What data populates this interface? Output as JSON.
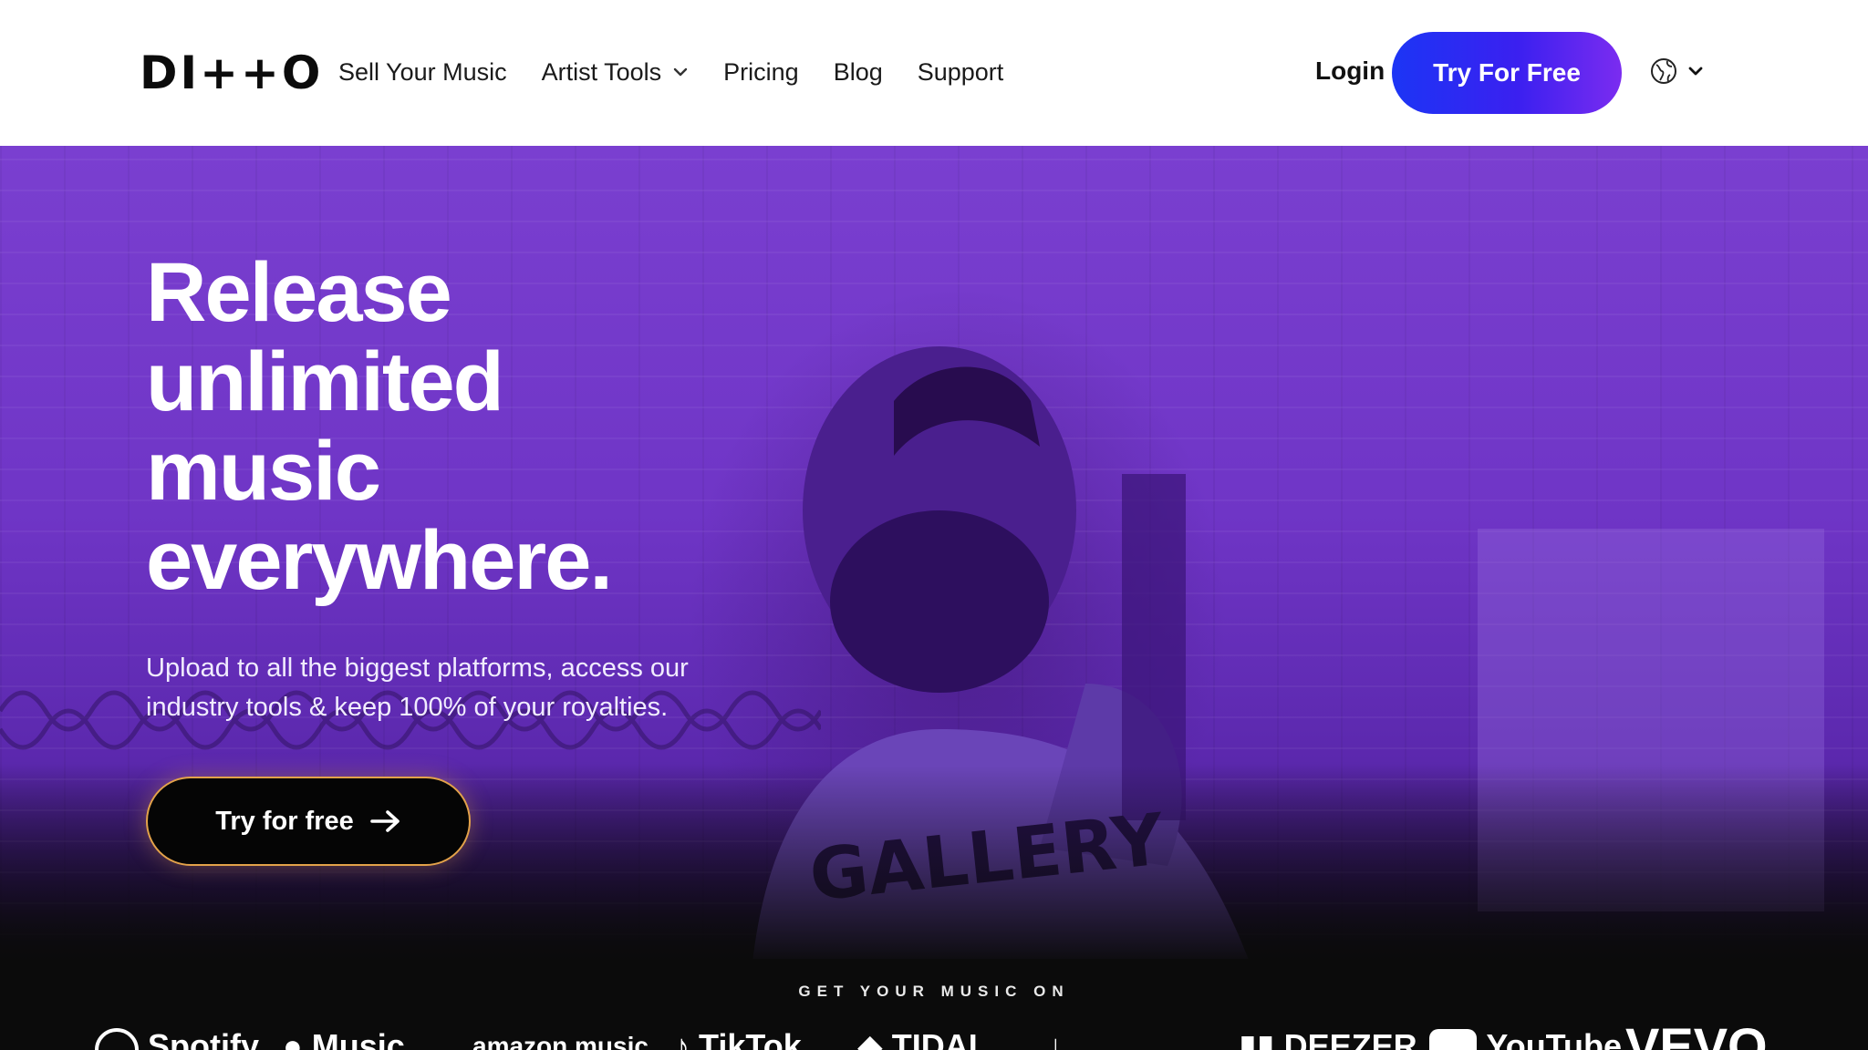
{
  "header": {
    "logo": "DI++O",
    "nav": [
      {
        "label": "Sell Your Music"
      },
      {
        "label": "Artist Tools",
        "has_dropdown": true
      },
      {
        "label": "Pricing"
      },
      {
        "label": "Blog"
      },
      {
        "label": "Support"
      }
    ],
    "login_label": "Login",
    "cta_label": "Try For Free",
    "language_icon": "globe-icon"
  },
  "hero": {
    "headline": {
      "line1": "Release",
      "line2": "unlimited",
      "line3": "music",
      "line4": "everywhere."
    },
    "subtext": "Upload to all the biggest platforms, access our industry tools & keep 100% of your royalties.",
    "cta_label": "Try for free",
    "background_color": "#6f35c6"
  },
  "platforms": {
    "label": "GET YOUR MUSIC ON",
    "logos": [
      "Spotify",
      "Music",
      "amazon music",
      "TikTok",
      "TIDAL",
      "",
      "DEEZER",
      "YouTube",
      "VEVO"
    ]
  },
  "colors": {
    "accent_blue": "#1c35f5",
    "accent_purple": "#7b2cf0",
    "cta_outline": "#e3a24a",
    "strip_bg": "#0b0b0b"
  }
}
